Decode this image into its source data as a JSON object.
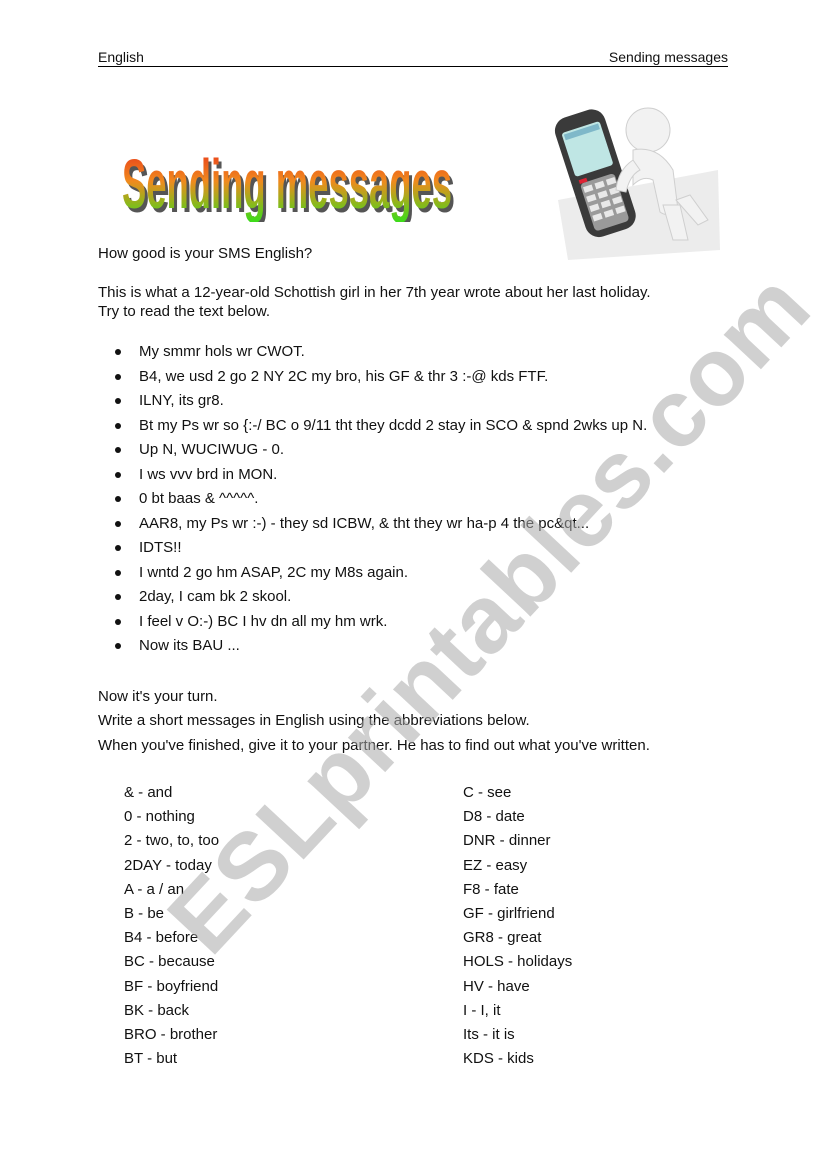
{
  "header": {
    "left": "English",
    "right": "Sending messages"
  },
  "title_art": {
    "text": "Sending messages",
    "gradient_top": "#e8321a",
    "gradient_mid": "#f08a1e",
    "gradient_bottom": "#33e01a"
  },
  "illustration": {
    "icon": "phone-person-illustration"
  },
  "intro": {
    "question": "How good is your SMS English?",
    "line1": "This is what a 12-year-old Schottish girl in her 7th year wrote about her last holiday.",
    "line2": "Try to read the text below."
  },
  "sms_items": [
    "My smmr hols wr CWOT.",
    "B4, we usd 2 go 2 NY 2C my bro, his GF & thr 3 :-@ kds FTF.",
    "ILNY, its gr8.",
    "Bt my Ps wr so {:-/ BC o 9/11 tht they dcdd 2 stay in SCO & spnd 2wks up N.",
    "Up N, WUCIWUG - 0.",
    "I ws vvv brd in MON.",
    "0 bt baas & ^^^^^.",
    "AAR8, my Ps wr :-) - they sd ICBW, & tht they wr ha-p 4 the pc&qt...",
    "IDTS!!",
    "I wntd 2 go hm ASAP, 2C my M8s again.",
    "2day, I cam bk 2 skool.",
    "I feel v O:-) BC I hv dn all my hm wrk.",
    "Now its BAU ..."
  ],
  "task": {
    "line1": "Now it's your turn.",
    "line2": "Write a short messages in English using the abbreviations below.",
    "line3": "When you've finished, give it to your partner. He has to find out what you've written."
  },
  "abbreviations_col1": [
    "& - and",
    "0 - nothing",
    "2 - two, to, too",
    "2DAY - today",
    "A - a / an",
    "B - be",
    "B4 - before",
    "BC - because",
    "BF - boyfriend",
    "BK - back",
    "BRO - brother",
    "BT - but"
  ],
  "abbreviations_col2": [
    "C - see",
    "D8 - date",
    "DNR - dinner",
    "EZ - easy",
    "F8 - fate",
    "GF - girlfriend",
    "GR8 - great",
    "HOLS - holidays",
    "HV - have",
    "I - I, it",
    "Its - it is",
    "KDS - kids"
  ],
  "watermark": "ESLprintables.com"
}
